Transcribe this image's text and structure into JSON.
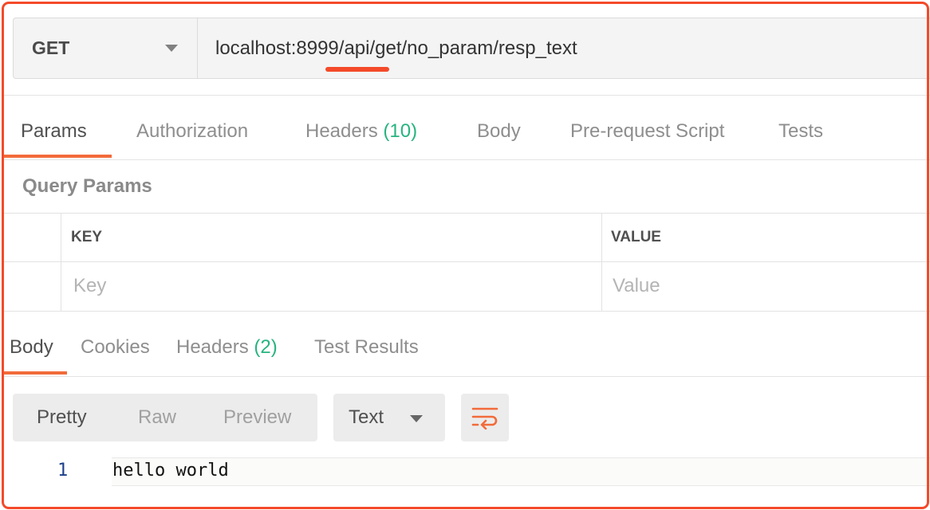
{
  "request": {
    "method": "GET",
    "url": "localhost:8999/api/get/no_param/resp_text"
  },
  "request_tabs": [
    {
      "label": "Params",
      "active": true
    },
    {
      "label": "Authorization"
    },
    {
      "label": "Headers ",
      "count": "(10)"
    },
    {
      "label": "Body"
    },
    {
      "label": "Pre-request Script"
    },
    {
      "label": "Tests"
    }
  ],
  "query_params": {
    "title": "Query Params",
    "headers": {
      "key": "KEY",
      "value": "VALUE"
    },
    "placeholders": {
      "key": "Key",
      "value": "Value"
    }
  },
  "response_tabs": [
    {
      "label": "Body",
      "active": true
    },
    {
      "label": "Cookies"
    },
    {
      "label": "Headers ",
      "count": "(2)"
    },
    {
      "label": "Test Results"
    }
  ],
  "response_view": {
    "modes": [
      "Pretty",
      "Raw",
      "Preview"
    ],
    "active_mode": "Pretty",
    "format": "Text",
    "wrap_icon": "wrap-lines-icon"
  },
  "response_body": {
    "lines": [
      {
        "number": "1",
        "text": "hello world"
      }
    ]
  },
  "colors": {
    "accent": "#f26b3a",
    "highlight_border": "#f44a2a",
    "count": "#26b47f"
  }
}
